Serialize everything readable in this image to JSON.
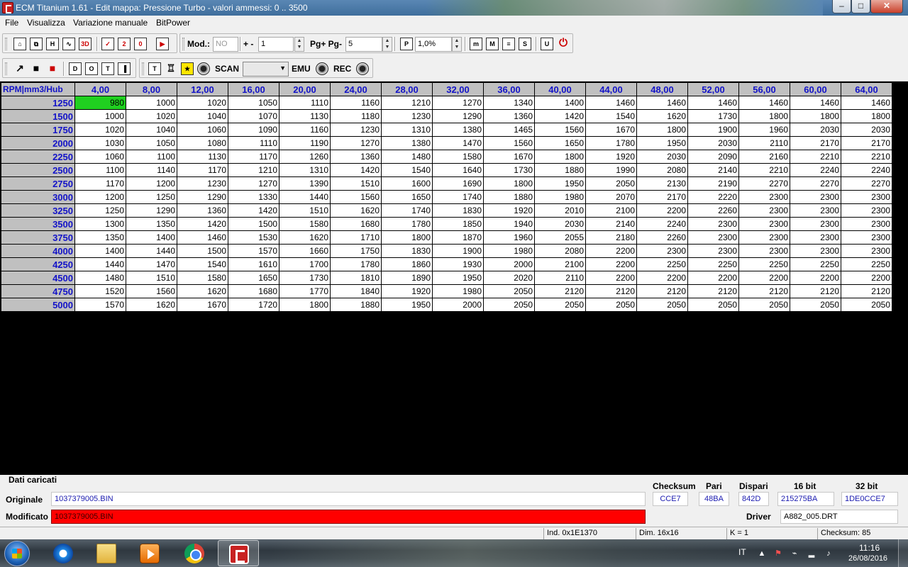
{
  "window": {
    "title": "ECM Titanium 1.61 - Edit mappa: Pressione Turbo - valori ammessi: 0 .. 3500",
    "min_glyph": "–",
    "max_glyph": "□",
    "close_glyph": "✕"
  },
  "menu": [
    "File",
    "Visualizza",
    "Variazione manuale",
    "BitPower"
  ],
  "toolbar1": {
    "icons_a": [
      "⌂",
      "⧉",
      "H",
      "∿",
      "3D"
    ],
    "icons_b": [
      "✓",
      "2",
      "0",
      "▶"
    ],
    "mod_label": "Mod.:",
    "mod_value": "NO",
    "plusminus_label": "+ -",
    "step_value": "1",
    "pg_label": "Pg+ Pg-",
    "pg_value": "5",
    "p_icon": "P",
    "percent_value": "1,0%",
    "icons_c": [
      "m",
      "M",
      "≡",
      "S"
    ],
    "icons_d": [
      "U",
      "⏻"
    ]
  },
  "toolbar2": {
    "icons_a": [
      "↗",
      "■",
      "■"
    ],
    "icons_b": [
      "D",
      "O",
      "T",
      "▐"
    ],
    "icons_c": [
      "T",
      "♖",
      "★"
    ],
    "scan_label": "SCAN",
    "scan_value": "",
    "emu_label": "EMU",
    "rec_label": "REC"
  },
  "grid": {
    "corner": "RPM|mm3/Hub",
    "columns": [
      "4,00",
      "8,00",
      "12,00",
      "16,00",
      "20,00",
      "24,00",
      "28,00",
      "32,00",
      "36,00",
      "40,00",
      "44,00",
      "48,00",
      "52,00",
      "56,00",
      "60,00",
      "64,00"
    ],
    "selected": [
      0,
      0
    ],
    "rows": [
      {
        "rpm": "1250",
        "values": [
          "980",
          "1000",
          "1020",
          "1050",
          "1110",
          "1160",
          "1210",
          "1270",
          "1340",
          "1400",
          "1460",
          "1460",
          "1460",
          "1460",
          "1460",
          "1460"
        ]
      },
      {
        "rpm": "1500",
        "values": [
          "1000",
          "1020",
          "1040",
          "1070",
          "1130",
          "1180",
          "1230",
          "1290",
          "1360",
          "1420",
          "1540",
          "1620",
          "1730",
          "1800",
          "1800",
          "1800"
        ]
      },
      {
        "rpm": "1750",
        "values": [
          "1020",
          "1040",
          "1060",
          "1090",
          "1160",
          "1230",
          "1310",
          "1380",
          "1465",
          "1560",
          "1670",
          "1800",
          "1900",
          "1960",
          "2030",
          "2030"
        ]
      },
      {
        "rpm": "2000",
        "values": [
          "1030",
          "1050",
          "1080",
          "1110",
          "1190",
          "1270",
          "1380",
          "1470",
          "1560",
          "1650",
          "1780",
          "1950",
          "2030",
          "2110",
          "2170",
          "2170"
        ]
      },
      {
        "rpm": "2250",
        "values": [
          "1060",
          "1100",
          "1130",
          "1170",
          "1260",
          "1360",
          "1480",
          "1580",
          "1670",
          "1800",
          "1920",
          "2030",
          "2090",
          "2160",
          "2210",
          "2210"
        ]
      },
      {
        "rpm": "2500",
        "values": [
          "1100",
          "1140",
          "1170",
          "1210",
          "1310",
          "1420",
          "1540",
          "1640",
          "1730",
          "1880",
          "1990",
          "2080",
          "2140",
          "2210",
          "2240",
          "2240"
        ]
      },
      {
        "rpm": "2750",
        "values": [
          "1170",
          "1200",
          "1230",
          "1270",
          "1390",
          "1510",
          "1600",
          "1690",
          "1800",
          "1950",
          "2050",
          "2130",
          "2190",
          "2270",
          "2270",
          "2270"
        ]
      },
      {
        "rpm": "3000",
        "values": [
          "1200",
          "1250",
          "1290",
          "1330",
          "1440",
          "1560",
          "1650",
          "1740",
          "1880",
          "1980",
          "2070",
          "2170",
          "2220",
          "2300",
          "2300",
          "2300"
        ]
      },
      {
        "rpm": "3250",
        "values": [
          "1250",
          "1290",
          "1360",
          "1420",
          "1510",
          "1620",
          "1740",
          "1830",
          "1920",
          "2010",
          "2100",
          "2200",
          "2260",
          "2300",
          "2300",
          "2300"
        ]
      },
      {
        "rpm": "3500",
        "values": [
          "1300",
          "1350",
          "1420",
          "1500",
          "1580",
          "1680",
          "1780",
          "1850",
          "1940",
          "2030",
          "2140",
          "2240",
          "2300",
          "2300",
          "2300",
          "2300"
        ]
      },
      {
        "rpm": "3750",
        "values": [
          "1350",
          "1400",
          "1460",
          "1530",
          "1620",
          "1710",
          "1800",
          "1870",
          "1960",
          "2055",
          "2180",
          "2260",
          "2300",
          "2300",
          "2300",
          "2300"
        ]
      },
      {
        "rpm": "4000",
        "values": [
          "1400",
          "1440",
          "1500",
          "1570",
          "1660",
          "1750",
          "1830",
          "1900",
          "1980",
          "2080",
          "2200",
          "2300",
          "2300",
          "2300",
          "2300",
          "2300"
        ]
      },
      {
        "rpm": "4250",
        "values": [
          "1440",
          "1470",
          "1540",
          "1610",
          "1700",
          "1780",
          "1860",
          "1930",
          "2000",
          "2100",
          "2200",
          "2250",
          "2250",
          "2250",
          "2250",
          "2250"
        ]
      },
      {
        "rpm": "4500",
        "values": [
          "1480",
          "1510",
          "1580",
          "1650",
          "1730",
          "1810",
          "1890",
          "1950",
          "2020",
          "2110",
          "2200",
          "2200",
          "2200",
          "2200",
          "2200",
          "2200"
        ]
      },
      {
        "rpm": "4750",
        "values": [
          "1520",
          "1560",
          "1620",
          "1680",
          "1770",
          "1840",
          "1920",
          "1980",
          "2050",
          "2120",
          "2120",
          "2120",
          "2120",
          "2120",
          "2120",
          "2120"
        ]
      },
      {
        "rpm": "5000",
        "values": [
          "1570",
          "1620",
          "1670",
          "1720",
          "1800",
          "1880",
          "1950",
          "2000",
          "2050",
          "2050",
          "2050",
          "2050",
          "2050",
          "2050",
          "2050",
          "2050"
        ]
      }
    ]
  },
  "bottom": {
    "section_label": "Dati caricati",
    "originale_label": "Originale",
    "originale_value": "1037379005.BIN",
    "modificato_label": "Modificato",
    "modificato_value": "1037379005.BIN",
    "checksum_label": "Checksum",
    "checksum_value": "CCE7",
    "pari_label": "Pari",
    "pari_value": "48BA",
    "dispari_label": "Dispari",
    "dispari_value": "842D",
    "bit16_label": "16 bit",
    "bit16_value": "215275BA",
    "bit32_label": "32 bit",
    "bit32_value": "1DE0CCE7",
    "driver_label": "Driver",
    "driver_value": "A882_005.DRT"
  },
  "status": {
    "ind": "Ind. 0x1E1370",
    "dim": "Dim. 16x16",
    "k": "K = 1",
    "checksum": "Checksum: 85"
  },
  "taskbar": {
    "lang": "IT",
    "time": "11:16",
    "date": "26/08/2016"
  },
  "colors": {
    "header_text": "#1313c8",
    "selected_cell": "#20d020",
    "modified_field": "#ff0000"
  }
}
